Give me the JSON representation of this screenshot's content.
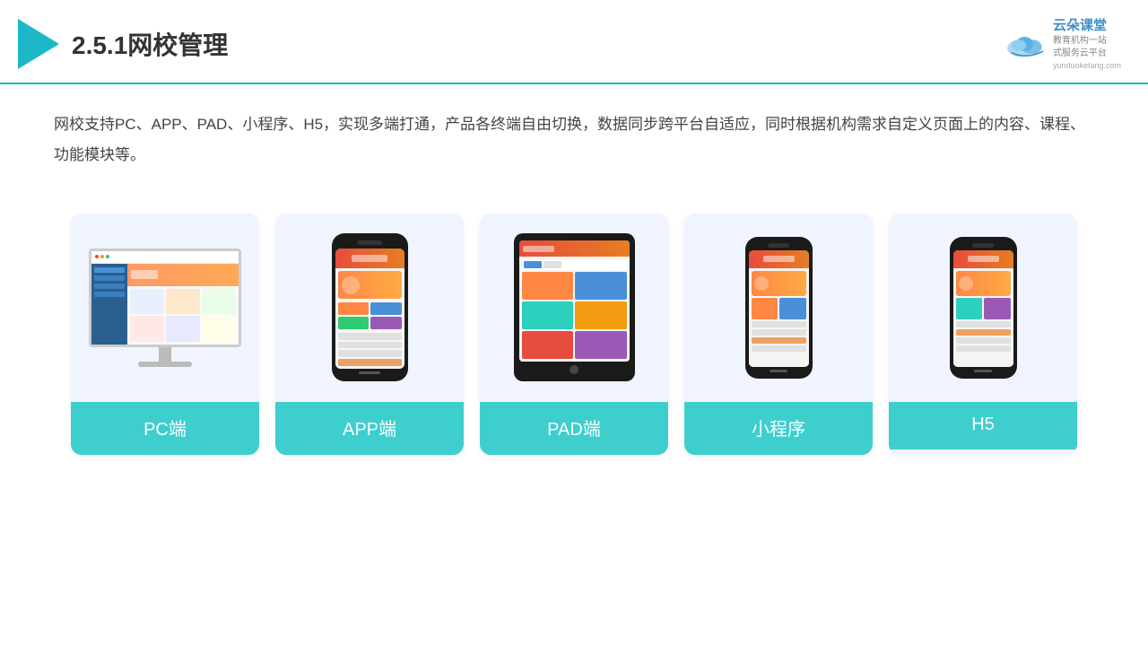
{
  "header": {
    "title": "2.5.1网校管理",
    "brand": {
      "name": "云朵课堂",
      "tagline1": "教育机构一站",
      "tagline2": "式服务云平台",
      "url": "yunduoketang.com"
    }
  },
  "description": {
    "text": "网校支持PC、APP、PAD、小程序、H5，实现多端打通，产品各终端自由切换，数据同步跨平台自适应，同时根据机构需求自定义页面上的内容、课程、功能模块等。"
  },
  "cards": [
    {
      "id": "pc",
      "label": "PC端"
    },
    {
      "id": "app",
      "label": "APP端"
    },
    {
      "id": "pad",
      "label": "PAD端"
    },
    {
      "id": "miniprogram",
      "label": "小程序"
    },
    {
      "id": "h5",
      "label": "H5"
    }
  ]
}
